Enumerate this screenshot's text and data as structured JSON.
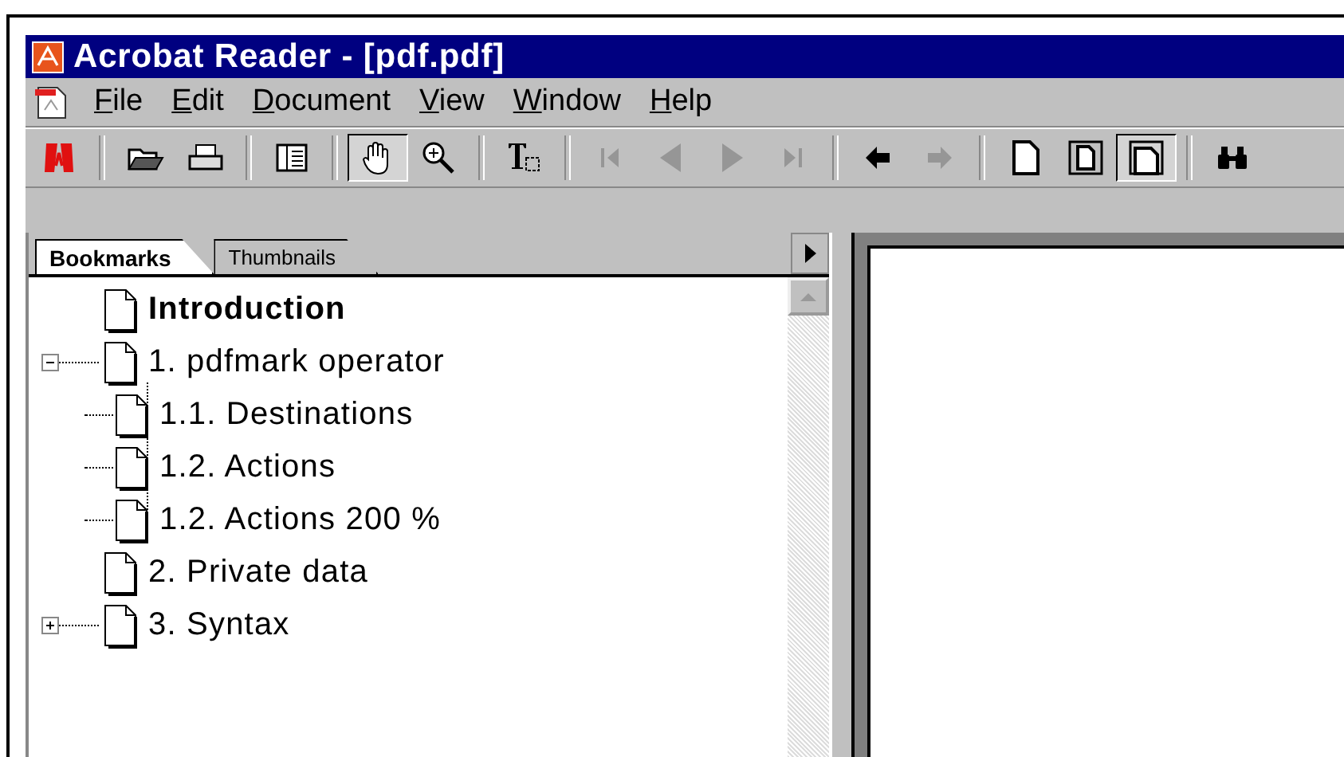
{
  "window": {
    "title": "Acrobat Reader - [pdf.pdf]"
  },
  "menu": [
    "File",
    "Edit",
    "Document",
    "View",
    "Window",
    "Help"
  ],
  "toolbar": [
    [
      {
        "kind": "logo",
        "selected": false,
        "disabled": false
      }
    ],
    [
      {
        "kind": "open",
        "selected": false,
        "disabled": false
      },
      {
        "kind": "print",
        "selected": false,
        "disabled": false
      }
    ],
    [
      {
        "kind": "panel",
        "selected": false,
        "disabled": false
      }
    ],
    [
      {
        "kind": "hand",
        "selected": true,
        "disabled": false
      },
      {
        "kind": "zoom",
        "selected": false,
        "disabled": false
      }
    ],
    [
      {
        "kind": "text",
        "selected": false,
        "disabled": false
      }
    ],
    [
      {
        "kind": "first",
        "selected": false,
        "disabled": true
      },
      {
        "kind": "prev",
        "selected": false,
        "disabled": true
      },
      {
        "kind": "next",
        "selected": false,
        "disabled": true
      },
      {
        "kind": "last",
        "selected": false,
        "disabled": true
      }
    ],
    [
      {
        "kind": "back",
        "selected": false,
        "disabled": false
      },
      {
        "kind": "forward",
        "selected": false,
        "disabled": true
      }
    ],
    [
      {
        "kind": "actual",
        "selected": false,
        "disabled": false
      },
      {
        "kind": "fitpage",
        "selected": false,
        "disabled": false
      },
      {
        "kind": "fitwidth",
        "selected": true,
        "disabled": false
      }
    ],
    [
      {
        "kind": "find",
        "selected": false,
        "disabled": false
      }
    ]
  ],
  "tabs": [
    {
      "label": "Bookmarks",
      "selected": true
    },
    {
      "label": "Thumbnails",
      "selected": false
    }
  ],
  "bookmarks": [
    {
      "label": "Introduction",
      "bold": true
    },
    {
      "label": "1. pdfmark operator",
      "bold": false,
      "expanded": true,
      "children": [
        {
          "label": "1.1. Destinations",
          "bold": false
        },
        {
          "label": "1.2. Actions",
          "bold": false
        },
        {
          "label": "1.2. Actions 200 %",
          "bold": false
        }
      ]
    },
    {
      "label": "2. Private data",
      "bold": false
    },
    {
      "label": "3. Syntax",
      "bold": false,
      "expanded": false
    }
  ]
}
